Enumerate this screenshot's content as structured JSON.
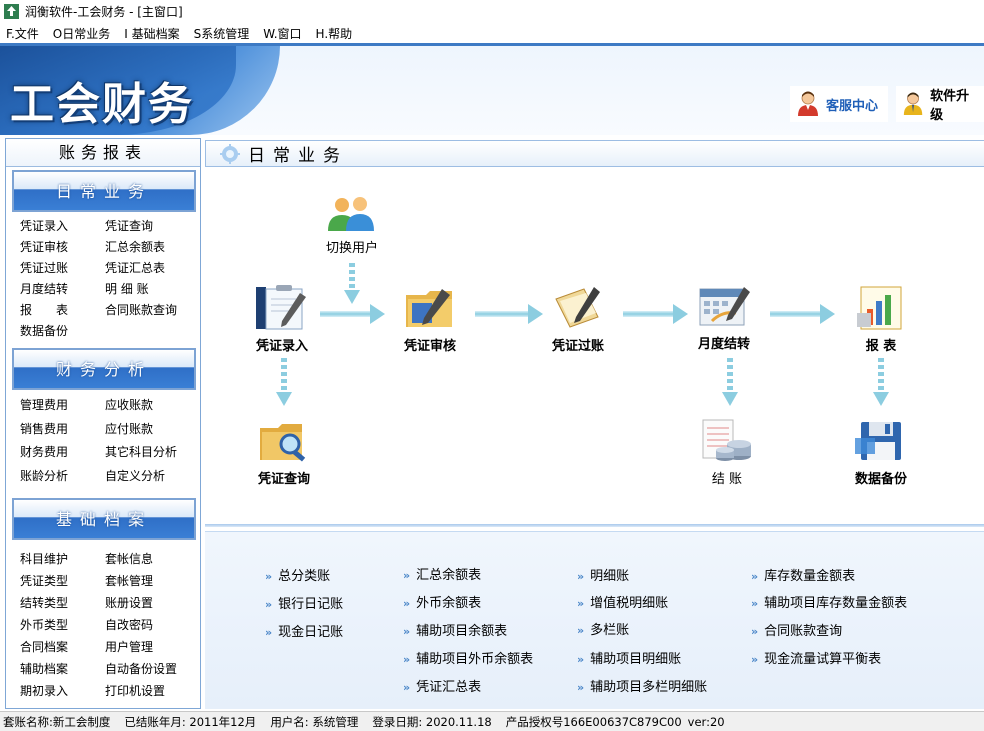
{
  "window": {
    "title": "润衡软件-工会财务 - [主窗口]"
  },
  "menu": [
    {
      "label": "F.文件"
    },
    {
      "label": "O日常业务"
    },
    {
      "label": "I 基础档案"
    },
    {
      "label": "S系统管理"
    },
    {
      "label": "W.窗口"
    },
    {
      "label": "H.帮助"
    }
  ],
  "banner": {
    "logo_text": "工会财务",
    "service_label": "客服中心",
    "upgrade_label": "软件升级"
  },
  "sidebar": {
    "title": "账务报表",
    "sections": [
      {
        "header": "日常业务",
        "items": [
          "凭证录入",
          "凭证查询",
          "凭证审核",
          "汇总余额表",
          "凭证过账",
          "凭证汇总表",
          "月度结转",
          "明 细 账",
          "报　　表",
          "合同账款查询",
          "数据备份",
          ""
        ]
      },
      {
        "header": "财务分析",
        "items": [
          "管理费用",
          "应收账款",
          "销售费用",
          "应付账款",
          "财务费用",
          "其它科目分析",
          "账龄分析",
          "自定义分析"
        ]
      },
      {
        "header": "基础档案",
        "items": [
          "科目维护",
          "套帐信息",
          "凭证类型",
          "套帐管理",
          "结转类型",
          "账册设置",
          "外币类型",
          "自改密码",
          "合同档案",
          "用户管理",
          "辅助档案",
          "自动备份设置",
          "期初录入",
          "打印机设置"
        ]
      }
    ]
  },
  "main": {
    "title": "日常业务",
    "flow": {
      "switch_user": "切换用户",
      "voucher_entry": "凭证录入",
      "voucher_audit": "凭证审核",
      "voucher_post": "凭证过账",
      "month_end": "月度结转",
      "reports": "报 表",
      "voucher_query": "凭证查询",
      "closing": "结 账",
      "data_backup": "数据备份"
    },
    "report_links": {
      "col1": [
        "总分类账",
        "银行日记账",
        "现金日记账"
      ],
      "col2": [
        "汇总余额表",
        "外币余额表",
        "辅助项目余额表",
        "辅助项目外币余额表",
        "凭证汇总表"
      ],
      "col3": [
        "明细账",
        "增值税明细账",
        "多栏账",
        "辅助项目明细账",
        "辅助项目多栏明细账"
      ],
      "col4": [
        "库存数量金额表",
        "辅助项目库存数量金额表",
        "合同账款查询",
        "现金流量试算平衡表"
      ]
    }
  },
  "status": {
    "account_name": "套账名称:新工会制度",
    "closed_month": "已结账年月: 2011年12月",
    "user": "用户名: 系统管理",
    "login_date": "登录日期: 2020.11.18",
    "license": "产品授权号166E00637C879C00",
    "version": "ver:20"
  },
  "colors": {
    "accent": "#3d7ac4",
    "sidebar_header": "#2f6fc7",
    "service_link": "#1f5fb8",
    "arrow": "#7fc3d8"
  },
  "icons": [
    "app-icon",
    "service-person-icon",
    "upgrade-person-icon",
    "gear-icon",
    "users-icon",
    "clipboard-pen-icon",
    "folder-pen-icon",
    "document-pen-icon",
    "calendar-pen-icon",
    "bar-chart-icon",
    "folder-search-icon",
    "coins-ledger-icon",
    "floppy-disk-icon"
  ]
}
